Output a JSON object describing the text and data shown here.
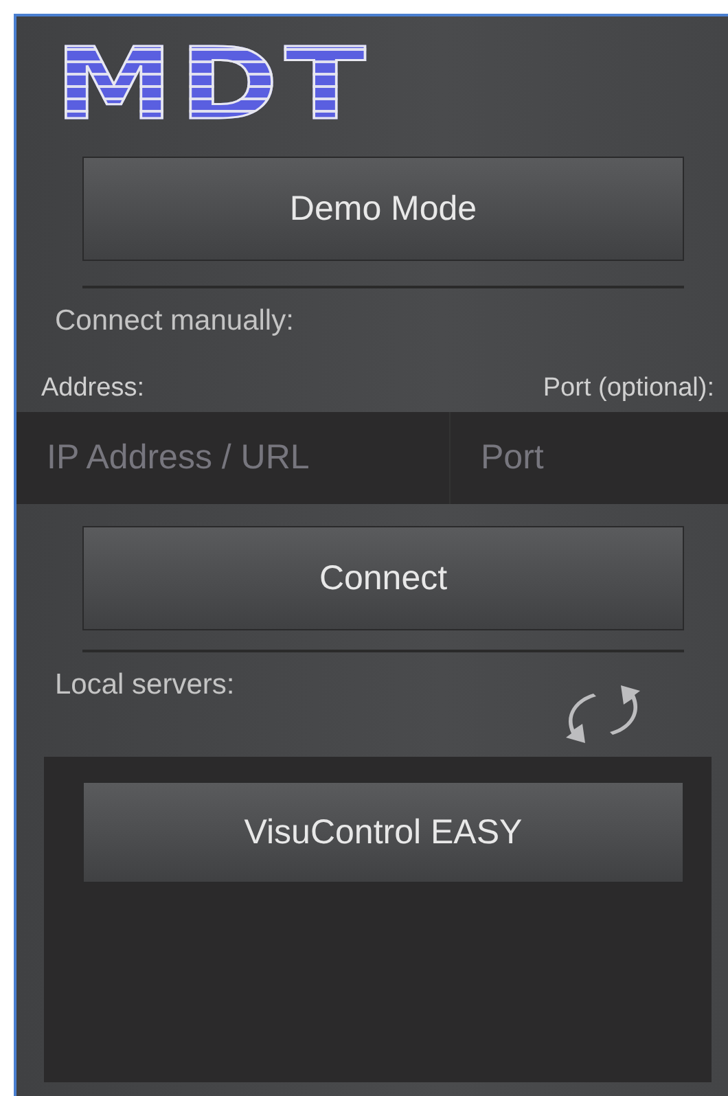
{
  "logo": "MDT",
  "demo_button": "Demo Mode",
  "manual": {
    "heading": "Connect manually:",
    "address_label": "Address:",
    "port_label": "Port (optional):",
    "address_placeholder": "IP Address / URL",
    "port_placeholder": "Port"
  },
  "connect_button": "Connect",
  "local": {
    "heading": "Local servers:",
    "servers": [
      "VisuControl EASY"
    ]
  }
}
